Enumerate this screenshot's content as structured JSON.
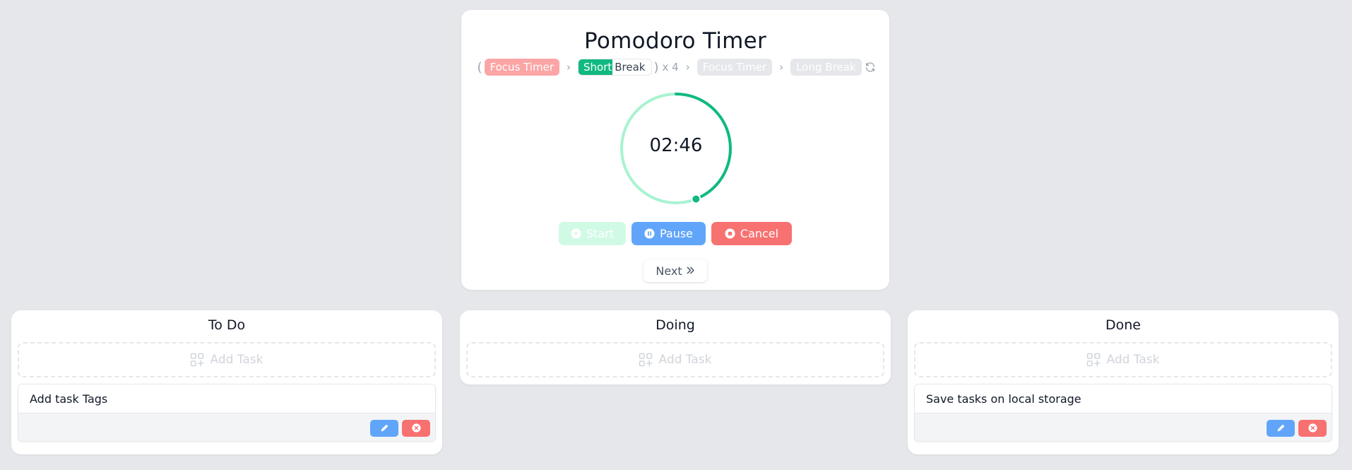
{
  "timer": {
    "title": "Pomodoro Timer",
    "phases": {
      "open_paren": "(",
      "close_paren": ")",
      "repeat": "x 4",
      "sep": "›",
      "focus_1": "Focus Timer",
      "short_break_a": "Short",
      "short_break_b": "Break",
      "focus_2": "Focus Timer",
      "long_break": "Long Break",
      "active_phase_progress": 0.48
    },
    "time_display": "02:46",
    "ring_remaining_fraction": 0.44,
    "buttons": {
      "start": "Start",
      "pause": "Pause",
      "cancel": "Cancel",
      "next": "Next"
    }
  },
  "colors": {
    "green": "#10b981",
    "green_light": "#a7f3d0",
    "blue": "#60a5fa",
    "red": "#f87171",
    "pink": "#fca5a5"
  },
  "board": {
    "todo": {
      "title": "To Do",
      "add_label": "Add Task",
      "tasks": [
        {
          "text": "Add task Tags"
        }
      ]
    },
    "doing": {
      "title": "Doing",
      "add_label": "Add Task",
      "tasks": []
    },
    "done": {
      "title": "Done",
      "add_label": "Add Task",
      "tasks": [
        {
          "text": "Save tasks on local storage"
        }
      ]
    }
  }
}
